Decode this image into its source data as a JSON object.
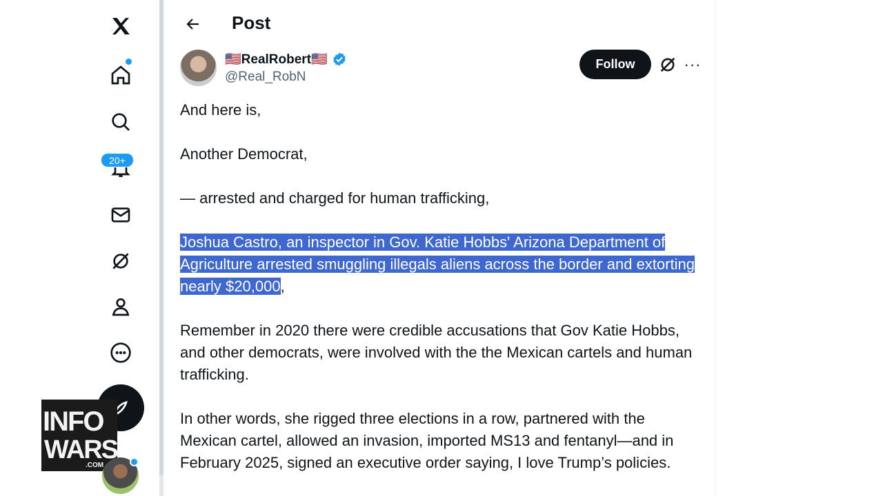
{
  "nav": {
    "notifications_badge": "20+"
  },
  "header": {
    "title": "Post"
  },
  "author": {
    "display_name": "🇺🇸RealRobert🇺🇸",
    "handle": "@Real_RobN",
    "verified": true
  },
  "actions": {
    "follow_label": "Follow",
    "more_label": "···"
  },
  "post": {
    "paragraphs": [
      "And here is,",
      "Another Democrat,",
      "— arrested and charged for human trafficking,"
    ],
    "highlighted": "Joshua Castro, an inspector in Gov. Katie Hobbs' Arizona Department of Agriculture arrested smuggling illegals aliens across the border and extorting nearly $20,000",
    "highlighted_suffix": ",",
    "para5": "Remember in 2020 there were credible accusations that Gov Katie Hobbs, and other democrats, were involved with the the Mexican cartels and human trafficking.",
    "para6": "In other words, she rigged three elections in a row, partnered with the Mexican cartel, allowed an invasion, imported MS13 and fentanyl—and in February 2025, signed an executive order saying, I love Trump’s policies."
  },
  "watermark": {
    "line1": "INFO",
    "line2": "WARS",
    "line3": ".COM"
  },
  "colors": {
    "accent": "#1d9bf0",
    "selection": "#3e67cf",
    "text": "#0f1419",
    "secondary": "#536471"
  }
}
